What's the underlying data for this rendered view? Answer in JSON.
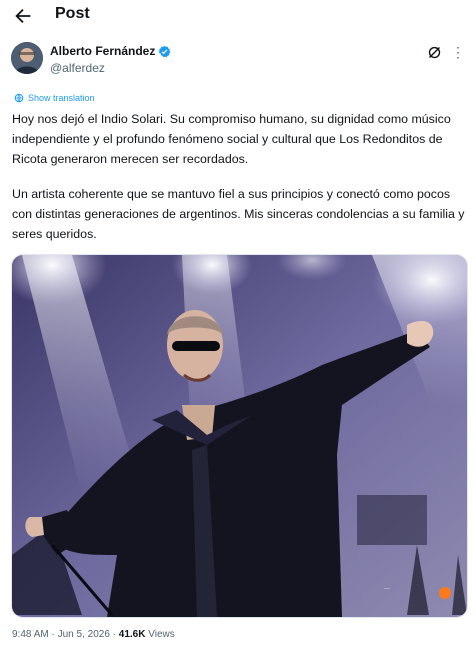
{
  "header": {
    "title": "Post"
  },
  "author": {
    "name": "Alberto Fernández",
    "handle": "@alferdez"
  },
  "post": {
    "translate_label": "Show translation",
    "paragraphs": [
      "Hoy nos dejó el Indio Solari. Su compromiso humano, su dignidad como músico independiente y el profundo fenómeno social y cultural que Los Redonditos de Ricota generaron merecen ser recordados.",
      "Un artista coherente que se mantuvo fiel a sus principios y conectó como pocos con distintas generaciones de argentinos. Mis sinceras condolencias a su familia y seres queridos."
    ]
  },
  "meta": {
    "time": "9:48 AM",
    "date": "Jun 5, 2026",
    "views_count": "41.6K",
    "views_label": "Views",
    "separator": "·"
  },
  "icons": {
    "back": "back-arrow-icon",
    "verified": "verified-badge-icon",
    "grok": "grok-icon",
    "more": "more-icon",
    "translate": "globe-icon"
  },
  "colors": {
    "accent": "#1d9bf0",
    "text": "#0f1419",
    "secondary": "#536471"
  }
}
